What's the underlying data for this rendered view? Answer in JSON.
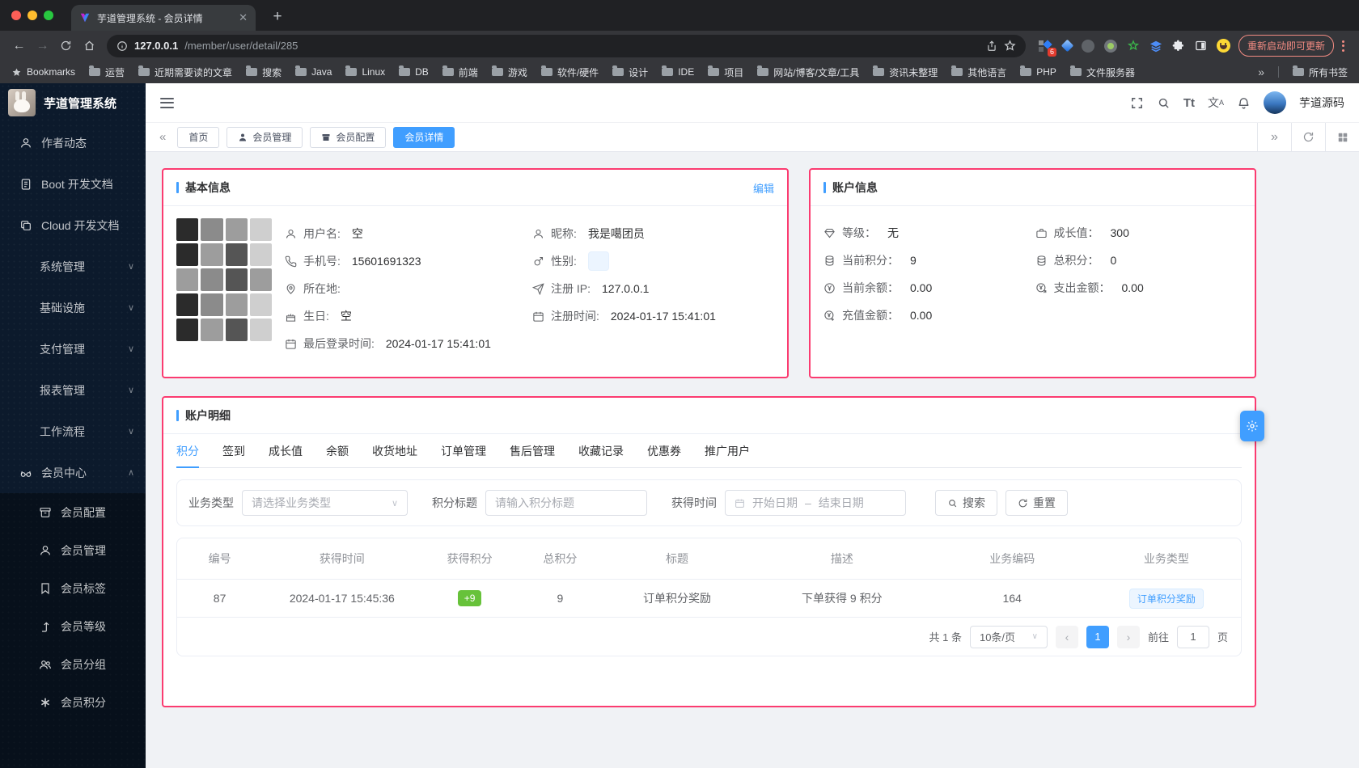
{
  "colors": {
    "accent": "#409eff",
    "highlight_border": "#fb3b70",
    "success": "#67c23a",
    "sidebar_bg": "#0c1a2c"
  },
  "browser": {
    "tab_title": "芋道管理系统 - 会员详情",
    "url_host": "127.0.0.1",
    "url_path": "/member/user/detail/285",
    "ext_badge": "6",
    "update_button": "重新启动即可更新",
    "bookmarks_label": "Bookmarks",
    "bookmarks": [
      "运营",
      "近期需要读的文章",
      "搜索",
      "Java",
      "Linux",
      "DB",
      "前端",
      "游戏",
      "软件/硬件",
      "设计",
      "IDE",
      "项目",
      "网站/博客/文章/工具",
      "资讯未整理",
      "其他语言",
      "PHP",
      "文件服务器"
    ],
    "overflow_chevron": "»",
    "all_bookmarks": "所有书签"
  },
  "sidebar": {
    "logo_title": "芋道管理系统",
    "items": [
      {
        "label": "作者动态",
        "icon": "user-icon"
      },
      {
        "label": "Boot 开发文档",
        "icon": "document-icon"
      },
      {
        "label": "Cloud 开发文档",
        "icon": "copy-icon"
      },
      {
        "label": "系统管理",
        "chevron": "∨"
      },
      {
        "label": "基础设施",
        "chevron": "∨"
      },
      {
        "label": "支付管理",
        "chevron": "∨"
      },
      {
        "label": "报表管理",
        "chevron": "∨"
      },
      {
        "label": "工作流程",
        "chevron": "∨"
      },
      {
        "label": "会员中心",
        "icon": "glasses-icon",
        "chevron": "∧"
      }
    ],
    "subitems": [
      {
        "label": "会员配置",
        "icon": "archive-icon"
      },
      {
        "label": "会员管理",
        "icon": "user-icon"
      },
      {
        "label": "会员标签",
        "icon": "bookmark-icon"
      },
      {
        "label": "会员等级",
        "icon": "level-up-icon"
      },
      {
        "label": "会员分组",
        "icon": "users-icon"
      },
      {
        "label": "会员积分",
        "icon": "asterisk-icon"
      }
    ]
  },
  "header": {
    "username": "芋道源码",
    "font_button": "Tt",
    "lang_char": "文",
    "lang_sup": "A"
  },
  "tabbar": {
    "tabs": [
      {
        "label": "首页"
      },
      {
        "label": "会员管理"
      },
      {
        "label": "会员配置"
      },
      {
        "label": "会员详情"
      }
    ]
  },
  "basic": {
    "title": "基本信息",
    "edit": "编辑",
    "left": [
      {
        "label": "用户名:",
        "value": "空"
      },
      {
        "label": "手机号:",
        "value": "15601691323"
      },
      {
        "label": "所在地:",
        "value": ""
      },
      {
        "label": "生日:",
        "value": "空"
      },
      {
        "label": "最后登录时间:",
        "value": "2024-01-17 15:41:01"
      }
    ],
    "right": [
      {
        "label": "昵称:",
        "value": "我是噶团员"
      },
      {
        "label": "性别:",
        "value": ""
      },
      {
        "label": "注册 IP:",
        "value": "127.0.0.1"
      },
      {
        "label": "注册时间:",
        "value": "2024-01-17 15:41:01"
      }
    ]
  },
  "account": {
    "title": "账户信息",
    "left": [
      {
        "label": "等级：",
        "value": "无"
      },
      {
        "label": "当前积分：",
        "value": "9"
      },
      {
        "label": "当前余额：",
        "value": "0.00"
      },
      {
        "label": "充值金额：",
        "value": "0.00"
      }
    ],
    "right": [
      {
        "label": "成长值：",
        "value": "300"
      },
      {
        "label": "总积分：",
        "value": "0"
      },
      {
        "label": "支出金额：",
        "value": "0.00"
      }
    ]
  },
  "detail": {
    "title": "账户明细",
    "tabs": [
      "积分",
      "签到",
      "成长值",
      "余额",
      "收货地址",
      "订单管理",
      "售后管理",
      "收藏记录",
      "优惠券",
      "推广用户"
    ],
    "filter": {
      "type_label": "业务类型",
      "type_placeholder": "请选择业务类型",
      "title_label": "积分标题",
      "title_placeholder": "请输入积分标题",
      "time_label": "获得时间",
      "start_placeholder": "开始日期",
      "range_sep": "–",
      "end_placeholder": "结束日期",
      "search": "搜索",
      "reset": "重置"
    },
    "table": {
      "headers": [
        "编号",
        "获得时间",
        "获得积分",
        "总积分",
        "标题",
        "描述",
        "业务编码",
        "业务类型"
      ],
      "rows": [
        {
          "id": "87",
          "time": "2024-01-17 15:45:36",
          "gain": "+9",
          "total": "9",
          "title": "订单积分奖励",
          "desc": "下单获得 9 积分",
          "code": "164",
          "type": "订单积分奖励"
        }
      ]
    },
    "pagination": {
      "total": "共 1 条",
      "size": "10条/页",
      "prev": "‹",
      "page": "1",
      "next": "›",
      "goto": "前往",
      "goto_value": "1",
      "unit": "页"
    }
  }
}
